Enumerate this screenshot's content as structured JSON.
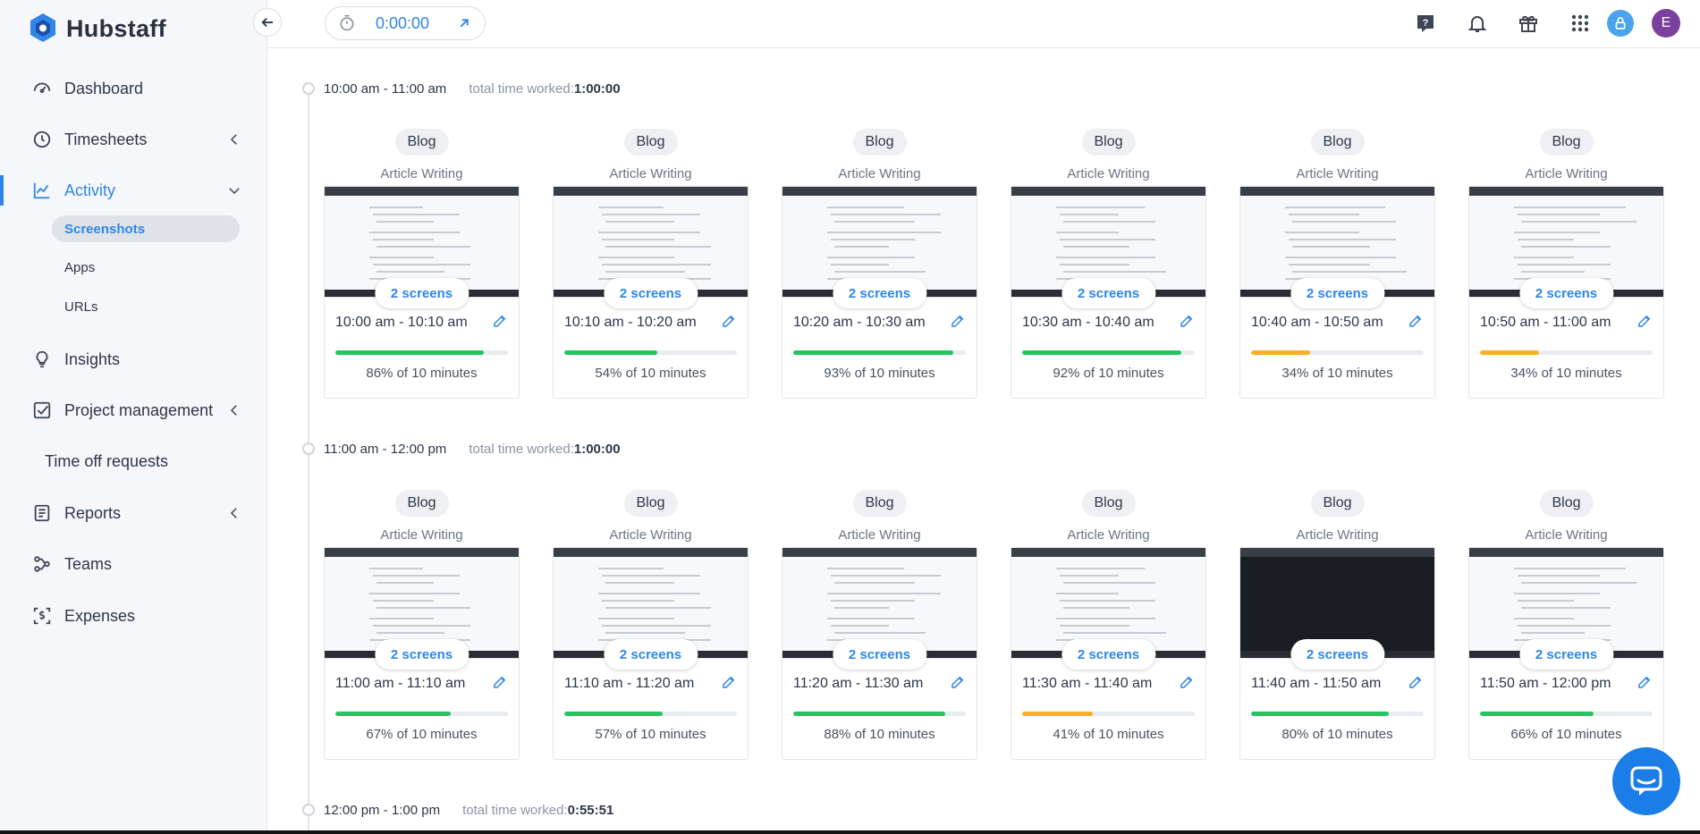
{
  "brand": {
    "name": "Hubstaff"
  },
  "sidebar": {
    "items": [
      {
        "label": "Dashboard",
        "icon": "dashboard-icon"
      },
      {
        "label": "Timesheets",
        "icon": "clock-icon"
      },
      {
        "label": "Activity",
        "icon": "chart-line-icon"
      },
      {
        "label": "Insights",
        "icon": "lightbulb-icon"
      },
      {
        "label": "Project management",
        "icon": "checkbox-icon"
      },
      {
        "label": "Time off requests",
        "icon": ""
      },
      {
        "label": "Reports",
        "icon": "report-icon"
      },
      {
        "label": "Teams",
        "icon": "teams-icon"
      },
      {
        "label": "Expenses",
        "icon": "expenses-icon"
      }
    ],
    "activity_sub": [
      {
        "label": "Screenshots"
      },
      {
        "label": "Apps"
      },
      {
        "label": "URLs"
      }
    ]
  },
  "topbar": {
    "timer_value": "0:00:00",
    "user_initial": "E"
  },
  "colors": {
    "accent": "#2f86e8",
    "green": "#22c55e",
    "orange": "#fbb024"
  },
  "slots": [
    {
      "range": "10:00 am - 11:00 am",
      "total_label": "total time worked:",
      "total_value": "1:00:00",
      "cards": [
        {
          "project": "Blog",
          "task": "Article Writing",
          "screens": "2 screens",
          "time": "10:00 am - 10:10 am",
          "percent": 86,
          "percent_label": "86% of 10 minutes"
        },
        {
          "project": "Blog",
          "task": "Article Writing",
          "screens": "2 screens",
          "time": "10:10 am - 10:20 am",
          "percent": 54,
          "percent_label": "54% of 10 minutes"
        },
        {
          "project": "Blog",
          "task": "Article Writing",
          "screens": "2 screens",
          "time": "10:20 am - 10:30 am",
          "percent": 93,
          "percent_label": "93% of 10 minutes"
        },
        {
          "project": "Blog",
          "task": "Article Writing",
          "screens": "2 screens",
          "time": "10:30 am - 10:40 am",
          "percent": 92,
          "percent_label": "92% of 10 minutes"
        },
        {
          "project": "Blog",
          "task": "Article Writing",
          "screens": "2 screens",
          "time": "10:40 am - 10:50 am",
          "percent": 34,
          "percent_label": "34% of 10 minutes"
        },
        {
          "project": "Blog",
          "task": "Article Writing",
          "screens": "2 screens",
          "time": "10:50 am - 11:00 am",
          "percent": 34,
          "percent_label": "34% of 10 minutes"
        }
      ]
    },
    {
      "range": "11:00 am - 12:00 pm",
      "total_label": "total time worked:",
      "total_value": "1:00:00",
      "cards": [
        {
          "project": "Blog",
          "task": "Article Writing",
          "screens": "2 screens",
          "time": "11:00 am - 11:10 am",
          "percent": 67,
          "percent_label": "67% of 10 minutes"
        },
        {
          "project": "Blog",
          "task": "Article Writing",
          "screens": "2 screens",
          "time": "11:10 am - 11:20 am",
          "percent": 57,
          "percent_label": "57% of 10 minutes"
        },
        {
          "project": "Blog",
          "task": "Article Writing",
          "screens": "2 screens",
          "time": "11:20 am - 11:30 am",
          "percent": 88,
          "percent_label": "88% of 10 minutes"
        },
        {
          "project": "Blog",
          "task": "Article Writing",
          "screens": "2 screens",
          "time": "11:30 am - 11:40 am",
          "percent": 41,
          "percent_label": "41% of 10 minutes"
        },
        {
          "project": "Blog",
          "task": "Article Writing",
          "screens": "2 screens",
          "time": "11:40 am - 11:50 am",
          "percent": 80,
          "percent_label": "80% of 10 minutes"
        },
        {
          "project": "Blog",
          "task": "Article Writing",
          "screens": "2 screens",
          "time": "11:50 am - 12:00 pm",
          "percent": 66,
          "percent_label": "66% of 10 minutes"
        }
      ]
    },
    {
      "range": "12:00 pm - 1:00 pm",
      "total_label": "total time worked:",
      "total_value": "0:55:51",
      "cards": []
    }
  ]
}
